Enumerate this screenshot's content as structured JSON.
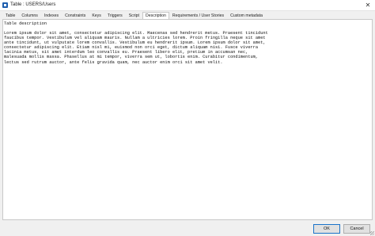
{
  "window": {
    "title": "Table : USERS/Users",
    "close_glyph": "✕"
  },
  "tabs": [
    {
      "label": "Table"
    },
    {
      "label": "Columns"
    },
    {
      "label": "Indexes"
    },
    {
      "label": "Constraints"
    },
    {
      "label": "Keys"
    },
    {
      "label": "Triggers"
    },
    {
      "label": "Script"
    },
    {
      "label": "Description",
      "active": true
    },
    {
      "label": "Requirements / User Stories"
    },
    {
      "label": "Custom metadata"
    }
  ],
  "description": {
    "label": "Table description",
    "lines": [
      "Lorem ipsum dolor sit amet, consectetur adipiscing elit. Maecenas sed hendrerit metus. Praesent tincidunt",
      "faucibus tempor. Vestibulum vel aliquam mauris. Nullam a ultricies lorem. Proin fringilla neque sit amet",
      "ante tincidunt, ut vulputate lorem convallis. Vestibulum eu hendrerit ipsum. Lorem ipsum dolor sit amet,",
      "consectetur adipiscing elit. Etiam nisl mi, euismod non orci eget, dictum aliquam nisi. Fusce viverra",
      "lacinia metus, sit amet interdum leo convallis eu. Praesent libero elit, pretium in accumsan nec,",
      "malesuada mollis massa. Phasellus at mi tempor, viverra sem ut, lobortis enim. Curabitur condimentum,",
      "lectus sed rutrum auctor, ante felis gravida quam, nec auctor enim orci sit amet velit."
    ]
  },
  "footer": {
    "ok_label": "OK",
    "cancel_label": "Cancel"
  }
}
